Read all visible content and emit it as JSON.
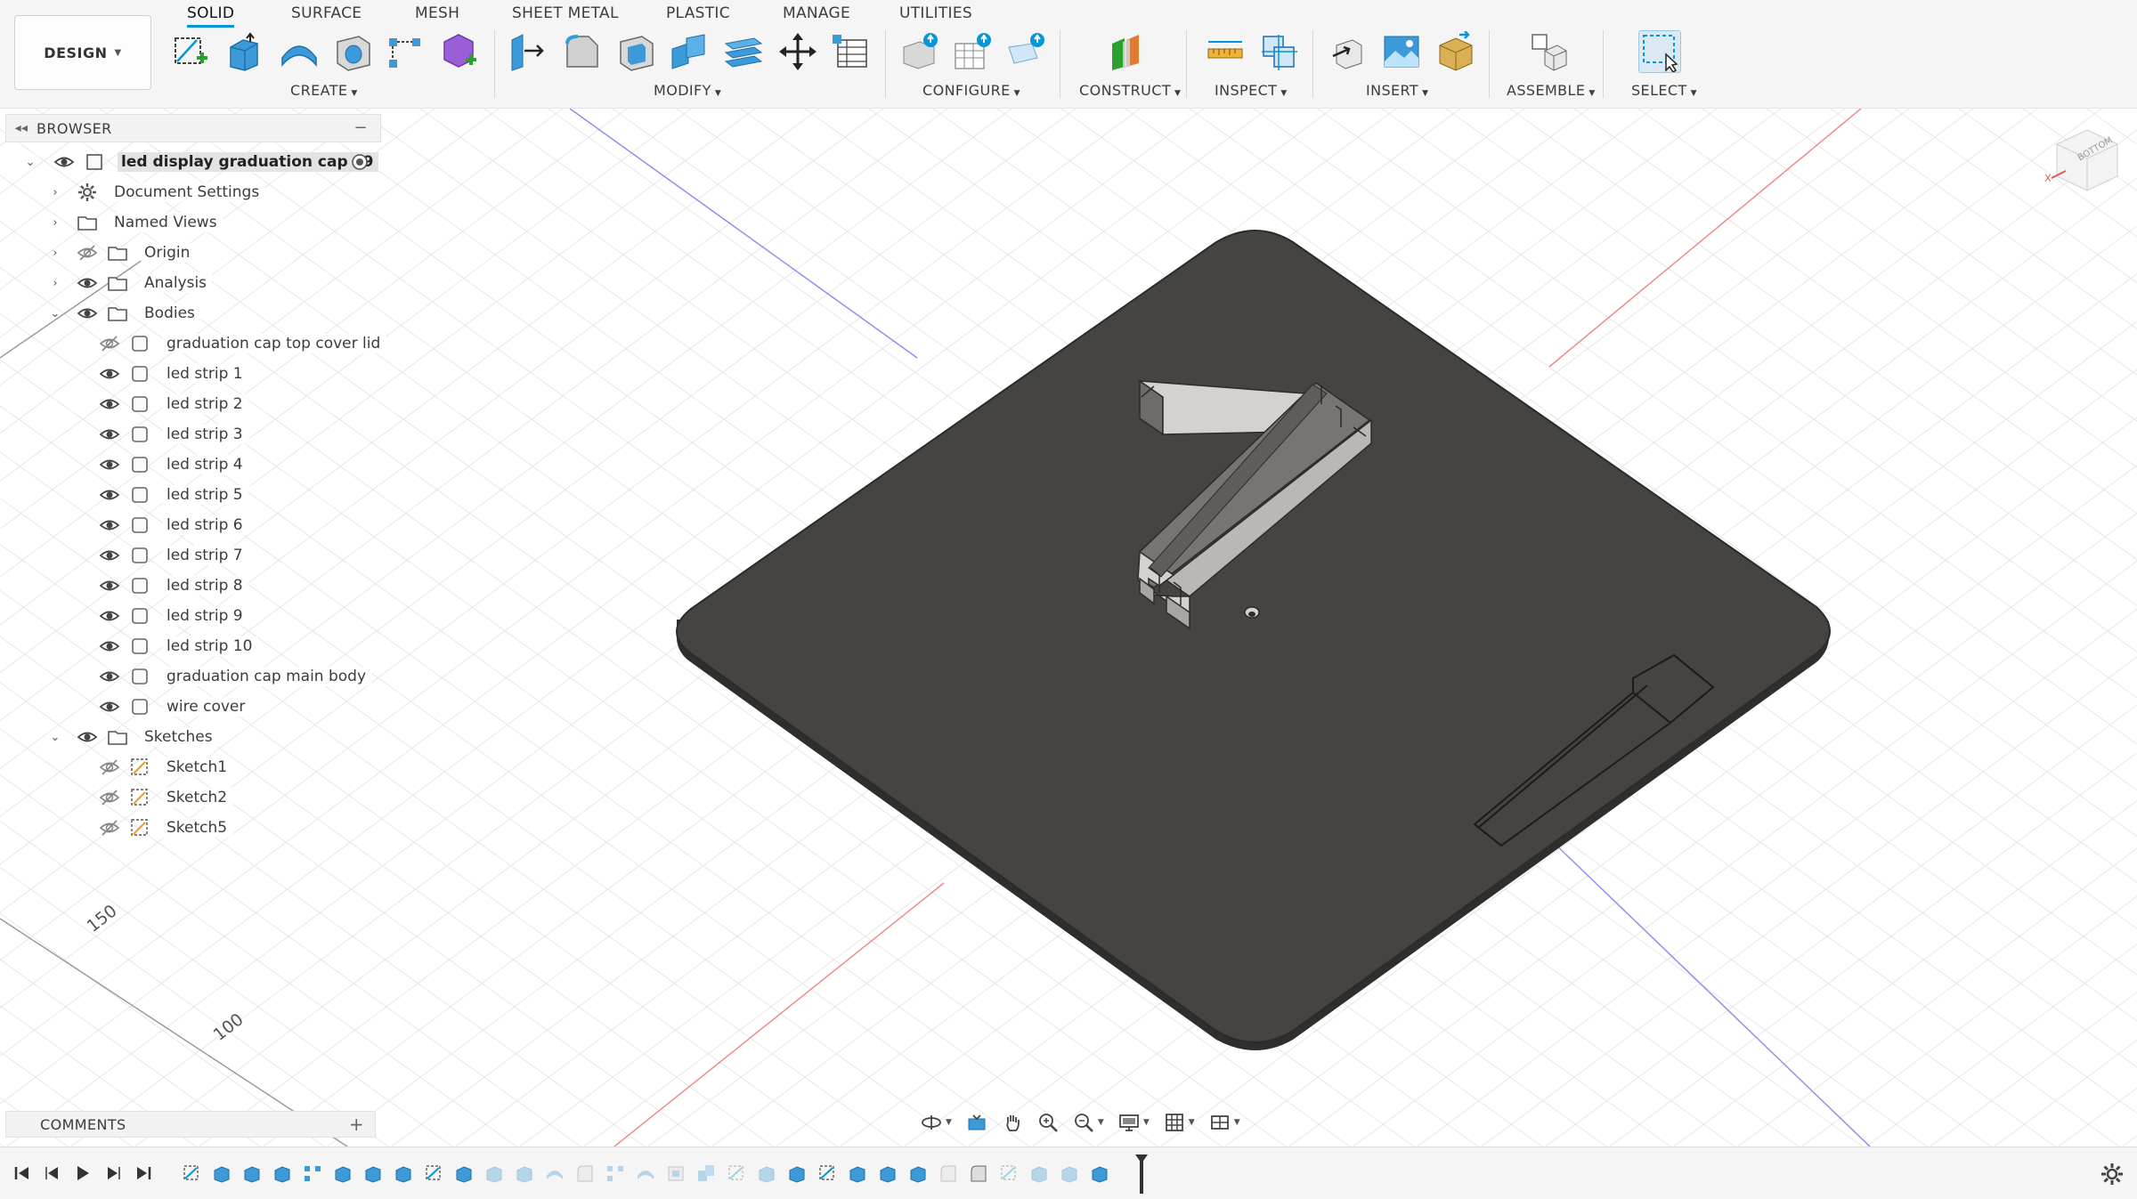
{
  "workspace": {
    "label": "DESIGN"
  },
  "tabs": [
    {
      "label": "SOLID",
      "active": true
    },
    {
      "label": "SURFACE"
    },
    {
      "label": "MESH"
    },
    {
      "label": "SHEET METAL"
    },
    {
      "label": "PLASTIC"
    },
    {
      "label": "MANAGE"
    },
    {
      "label": "UTILITIES"
    }
  ],
  "groups": {
    "create": "CREATE",
    "modify": "MODIFY",
    "configure": "CONFIGURE",
    "construct": "CONSTRUCT",
    "inspect": "INSPECT",
    "insert": "INSERT",
    "assemble": "ASSEMBLE",
    "select": "SELECT"
  },
  "browser": {
    "title": "BROWSER",
    "document": "led display graduation cap v9",
    "items": {
      "document_settings": "Document Settings",
      "named_views": "Named Views",
      "origin": "Origin",
      "analysis": "Analysis",
      "bodies": "Bodies",
      "sketches": "Sketches"
    },
    "bodies": [
      {
        "label": "graduation cap top cover lid",
        "visible": false
      },
      {
        "label": "led strip 1",
        "visible": true
      },
      {
        "label": "led strip 2",
        "visible": true
      },
      {
        "label": "led strip 3",
        "visible": true
      },
      {
        "label": "led strip 4",
        "visible": true
      },
      {
        "label": "led strip 5",
        "visible": true
      },
      {
        "label": "led strip 6",
        "visible": true
      },
      {
        "label": "led strip 7",
        "visible": true
      },
      {
        "label": "led strip 8",
        "visible": true
      },
      {
        "label": "led strip 9",
        "visible": true
      },
      {
        "label": "led strip 10",
        "visible": true
      },
      {
        "label": "graduation cap main body",
        "visible": true
      },
      {
        "label": "wire cover",
        "visible": true
      }
    ],
    "sketches": [
      {
        "label": "Sketch1",
        "visible": false
      },
      {
        "label": "Sketch2",
        "visible": false
      },
      {
        "label": "Sketch5",
        "visible": false
      }
    ]
  },
  "comments": {
    "title": "COMMENTS"
  },
  "viewcube": {
    "face": "BOTTOM",
    "axis_x": "X"
  },
  "grid_labels": [
    "150",
    "100"
  ],
  "colors": {
    "accent": "#0696d7",
    "body": "#464441",
    "edge": "#2c2b29",
    "grid": "#e6e6e6"
  }
}
